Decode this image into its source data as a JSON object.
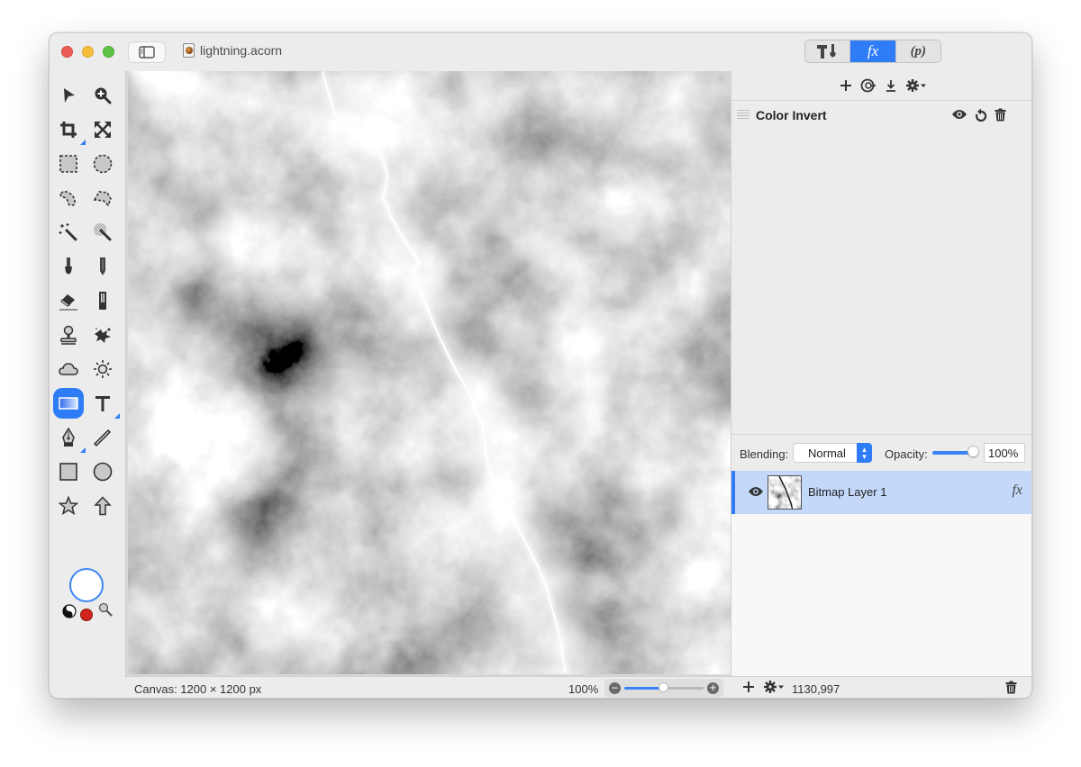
{
  "window": {
    "title": "lightning.acorn",
    "traffic_lights": [
      "close",
      "minimize",
      "zoom"
    ]
  },
  "toolbar": {
    "segments": [
      {
        "name": "tools",
        "label": "",
        "icon": "hammer-icon"
      },
      {
        "name": "effects",
        "label": "fx",
        "selected": true
      },
      {
        "name": "properties",
        "label": "(p)"
      }
    ]
  },
  "tools": [
    {
      "name": "select-arrow",
      "icon": "arrow-icon"
    },
    {
      "name": "zoom",
      "icon": "zoom-in-icon"
    },
    {
      "name": "crop",
      "icon": "crop-icon"
    },
    {
      "name": "transform",
      "icon": "expand-arrows-icon"
    },
    {
      "name": "rect-select",
      "icon": "rect-marquee-icon"
    },
    {
      "name": "ellipse-select",
      "icon": "ellipse-marquee-icon"
    },
    {
      "name": "lasso",
      "icon": "lasso-icon"
    },
    {
      "name": "polygon-lasso",
      "icon": "polygon-lasso-icon"
    },
    {
      "name": "magic-wand",
      "icon": "magic-wand-icon"
    },
    {
      "name": "instant-alpha",
      "icon": "instant-alpha-icon"
    },
    {
      "name": "brush",
      "icon": "brush-icon"
    },
    {
      "name": "pencil",
      "icon": "pencil-icon"
    },
    {
      "name": "eraser",
      "icon": "eraser-icon"
    },
    {
      "name": "paint-bucket",
      "icon": "bucket-icon"
    },
    {
      "name": "clone",
      "icon": "stamp-icon"
    },
    {
      "name": "smudge",
      "icon": "splatter-icon"
    },
    {
      "name": "burn",
      "icon": "cloud-icon"
    },
    {
      "name": "dodge",
      "icon": "sun-icon"
    },
    {
      "name": "gradient",
      "icon": "gradient-icon",
      "active": true
    },
    {
      "name": "text",
      "icon": "text-icon"
    },
    {
      "name": "bezier",
      "icon": "pen-nib-icon"
    },
    {
      "name": "line",
      "icon": "line-icon"
    },
    {
      "name": "rectangle",
      "icon": "rectangle-icon"
    },
    {
      "name": "oval",
      "icon": "circle-icon"
    },
    {
      "name": "star",
      "icon": "star-icon"
    },
    {
      "name": "arrow-shape",
      "icon": "up-arrow-icon"
    }
  ],
  "colors": {
    "fill": "#ffffff",
    "stroke": "#d0261e",
    "accent": "#2e7cf6"
  },
  "filters": {
    "items": [
      {
        "label": "Color Invert"
      }
    ]
  },
  "layer_controls": {
    "blending_label": "Blending:",
    "blending_value": "Normal",
    "opacity_label": "Opacity:",
    "opacity_value": "100%",
    "opacity_fraction": 1.0
  },
  "layers": [
    {
      "name": "Bitmap Layer 1",
      "visible": true,
      "selected": true,
      "has_fx": true,
      "fx_label": "fx"
    }
  ],
  "status": {
    "canvas_size": "Canvas: 1200 × 1200 px",
    "zoom": "100%",
    "zoom_fraction": 0.5,
    "coords": "1130,997"
  }
}
